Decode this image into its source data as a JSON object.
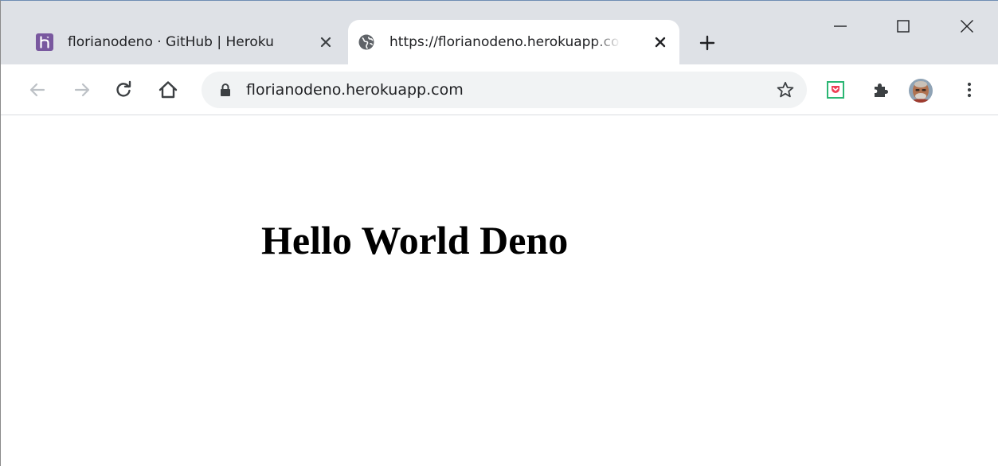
{
  "tabs": [
    {
      "title": "florianodeno · GitHub | Heroku",
      "favicon": "heroku-icon",
      "active": false
    },
    {
      "title": "https://florianodeno.herokuapp.com",
      "favicon": "globe-icon",
      "active": true
    }
  ],
  "toolbar": {
    "url": "florianodeno.herokuapp.com"
  },
  "page": {
    "heading": "Hello World Deno"
  },
  "colors": {
    "tabstrip_bg": "#dee1e6",
    "omnibox_bg": "#f1f3f4",
    "heroku_purple": "#79589f",
    "text": "#202124",
    "icon": "#5f6368",
    "disabled_icon": "#bdc1c6"
  },
  "icons": {
    "new_tab": "plus-icon",
    "minimize": "minimize-icon",
    "maximize": "maximize-icon",
    "close_window": "close-icon",
    "back": "arrow-left-icon",
    "forward": "arrow-right-icon",
    "reload": "reload-icon",
    "home": "home-icon",
    "lock": "lock-icon",
    "bookmark": "star-icon",
    "pocket": "pocket-extension-icon",
    "extensions": "puzzle-icon",
    "profile": "avatar",
    "menu": "kebab-menu-icon"
  }
}
